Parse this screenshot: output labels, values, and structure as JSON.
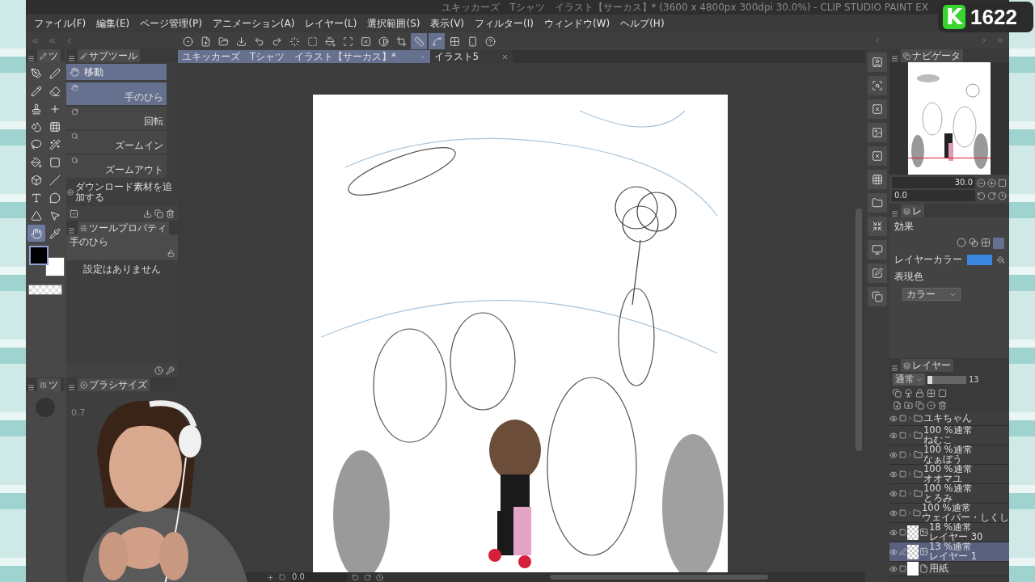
{
  "title": "ユキッカーズ　Tシャツ　イラスト【サーカス】* (3600 x 4800px 300dpi 30.0%) - CLIP STUDIO PAINT EX",
  "badge": {
    "letter": "K",
    "count": "1622"
  },
  "menu": [
    "ファイル(F)",
    "編集(E)",
    "ページ管理(P)",
    "アニメーション(A)",
    "レイヤー(L)",
    "選択範囲(S)",
    "表示(V)",
    "フィルター(I)",
    "ウィンドウ(W)",
    "ヘルプ(H)"
  ],
  "commands": [
    {
      "kind": "app",
      "on": false
    },
    {
      "kind": "new",
      "on": false
    },
    {
      "kind": "open",
      "on": false
    },
    {
      "kind": "export",
      "on": false
    },
    {
      "kind": "undo",
      "on": false
    },
    {
      "kind": "redo",
      "on": false
    },
    {
      "kind": "loading",
      "on": false
    },
    {
      "kind": "clear",
      "on": false
    },
    {
      "kind": "fill",
      "on": false
    },
    {
      "kind": "transform",
      "on": false
    },
    {
      "kind": "deselect",
      "on": false
    },
    {
      "kind": "invert",
      "on": false
    },
    {
      "kind": "crop",
      "on": false
    },
    {
      "kind": "snap-ruler",
      "on": true
    },
    {
      "kind": "snap-special",
      "on": true
    },
    {
      "kind": "snap-grid",
      "on": false
    },
    {
      "kind": "device",
      "on": false
    },
    {
      "kind": "help",
      "on": false
    }
  ],
  "tool_tab": "ツ",
  "tools": [
    {
      "kind": "pen",
      "selected": false
    },
    {
      "kind": "marker",
      "selected": false
    },
    {
      "kind": "pencil",
      "selected": false
    },
    {
      "kind": "eraser",
      "selected": false
    },
    {
      "kind": "stamp",
      "selected": false
    },
    {
      "kind": "plus",
      "selected": false
    },
    {
      "kind": "droplets",
      "selected": false
    },
    {
      "kind": "grid",
      "selected": false
    },
    {
      "kind": "lasso",
      "selected": false
    },
    {
      "kind": "wand",
      "selected": false
    },
    {
      "kind": "bucket",
      "selected": false
    },
    {
      "kind": "gradient",
      "selected": false
    },
    {
      "kind": "object",
      "selected": false
    },
    {
      "kind": "line",
      "selected": false
    },
    {
      "kind": "text",
      "selected": false
    },
    {
      "kind": "balloon",
      "selected": false
    },
    {
      "kind": "ruler",
      "selected": false
    },
    {
      "kind": "pointer",
      "selected": false
    },
    {
      "kind": "hand",
      "selected": true
    },
    {
      "kind": "eyedropper",
      "selected": false
    }
  ],
  "colors": [
    {
      "color": "#000000",
      "selected": true
    },
    {
      "color": "#ffffff",
      "selected": false
    }
  ],
  "subtool_panel": {
    "tab": "サブツール",
    "group": "移動",
    "items": [
      {
        "label": "手のひら",
        "kind": "hand",
        "selected": true
      },
      {
        "label": "回転",
        "kind": "rotate",
        "selected": false
      },
      {
        "label": "ズームイン",
        "kind": "zoom",
        "selected": false
      },
      {
        "label": "ズームアウト",
        "kind": "zoom",
        "selected": false
      }
    ],
    "add": "ダウンロード素材を追加する"
  },
  "tool_property": {
    "tab": "ツールプロパティ",
    "tool": "手のひら",
    "message": "設定はありません"
  },
  "lower_tool_tab": "ツ",
  "brush_size": {
    "tab": "ブラシサイズ",
    "reading": "0.7"
  },
  "documents": [
    {
      "label": "ユキッカーズ　Tシャツ　イラスト【サーカス】*",
      "selected": true
    },
    {
      "label": "イラスト5",
      "selected": false
    }
  ],
  "canvas_bar": {
    "angle": "0.0"
  },
  "navigator": {
    "tab": "ナビゲータ",
    "zoom": "30.0",
    "angle": "0.0"
  },
  "layer_property": {
    "tab": "レ",
    "effect": "効果",
    "layer_color": "レイヤーカラー",
    "color": "#3b87e0",
    "expression": "表現色",
    "mode": "カラー"
  },
  "layer_panel": {
    "tab": "レイヤー",
    "blend": "通常",
    "level": 0.13,
    "opacity": "13",
    "layers": [
      {
        "kind": "folder",
        "name": "ユキちゃん",
        "visible": true,
        "selected": false,
        "editing": false
      },
      {
        "kind": "folder",
        "mode": "100 %通常",
        "name": "ねむこ",
        "visible": true,
        "selected": false,
        "editing": false
      },
      {
        "kind": "folder",
        "mode": "100 %通常",
        "name": "なぁぼう",
        "visible": true,
        "selected": false,
        "editing": false
      },
      {
        "kind": "folder",
        "mode": "100 %通常",
        "name": "オオマユ",
        "visible": true,
        "selected": false,
        "editing": false
      },
      {
        "kind": "folder",
        "mode": "100 %通常",
        "name": "とろみ",
        "visible": true,
        "selected": false,
        "editing": false
      },
      {
        "kind": "folder",
        "mode": "100 %通常",
        "name": "ウェイバー・しくし",
        "visible": true,
        "selected": false,
        "editing": false
      },
      {
        "kind": "raster",
        "mode": "18 %通常",
        "name": "レイヤー 30",
        "visible": true,
        "selected": false,
        "editing": false
      },
      {
        "kind": "raster",
        "mode": "13 %通常",
        "name": "レイヤー 1",
        "visible": true,
        "selected": true,
        "editing": true
      },
      {
        "kind": "paper",
        "name": "用紙",
        "visible": true,
        "selected": false,
        "editing": false
      }
    ]
  }
}
